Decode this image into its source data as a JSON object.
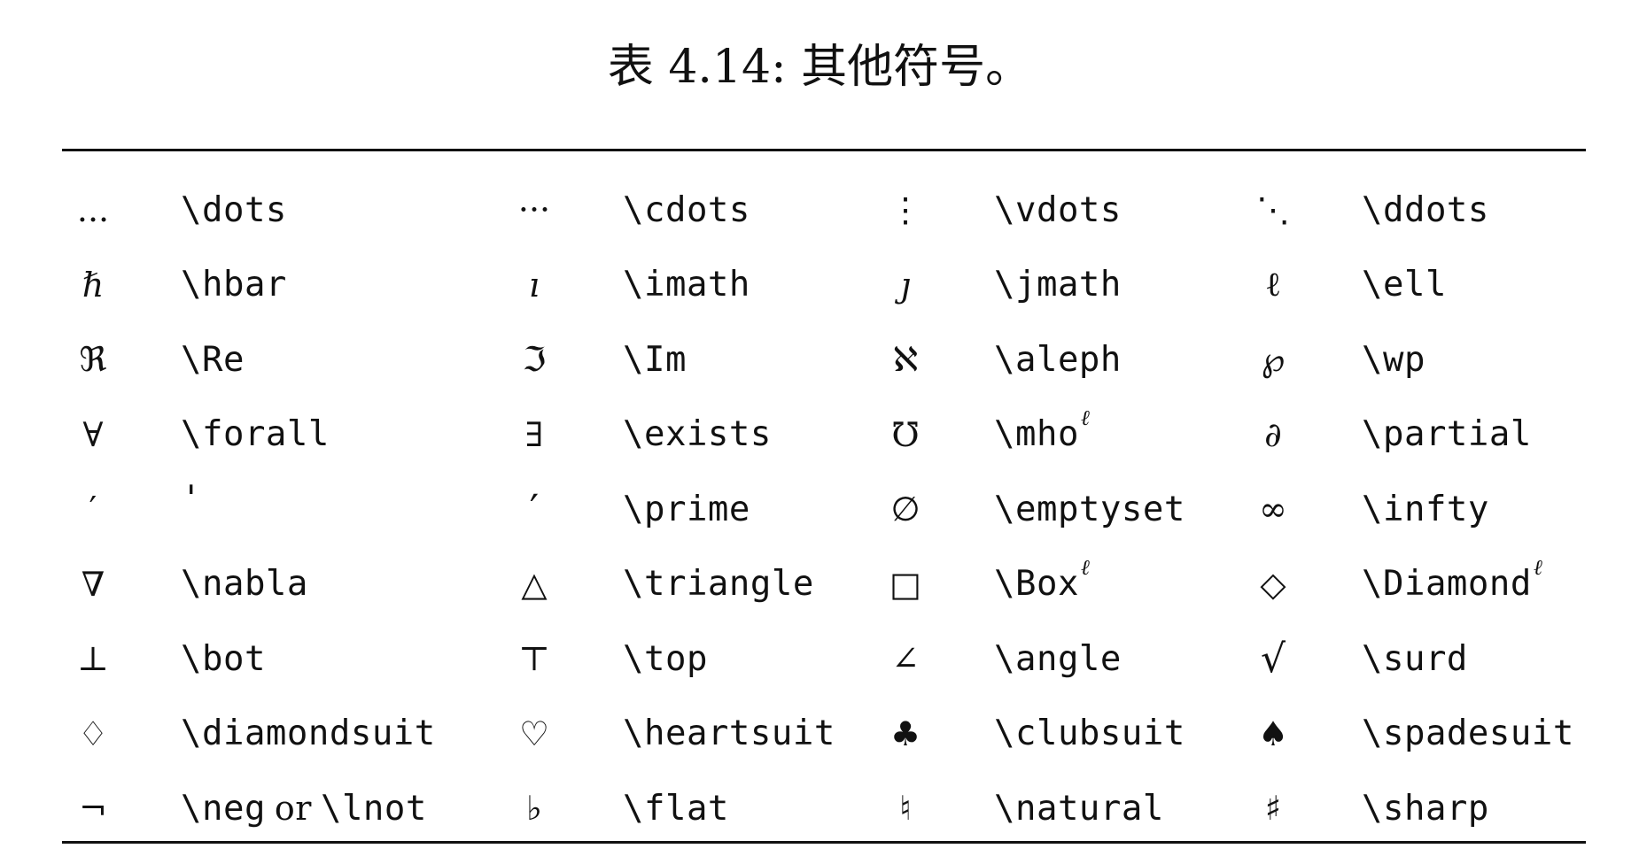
{
  "caption": "表 4.14: 其他符号。",
  "rows": [
    [
      {
        "sym": "...",
        "cmd": "\\dots"
      },
      {
        "sym": "···",
        "cmd": "\\cdots"
      },
      {
        "sym": "⋮",
        "cmd": "\\vdots"
      },
      {
        "sym": "⋱",
        "cmd": "\\ddots"
      }
    ],
    [
      {
        "sym": "ℏ",
        "cmd": "\\hbar"
      },
      {
        "sym": "ı",
        "cmd": "\\imath"
      },
      {
        "sym": "ȷ",
        "cmd": "\\jmath"
      },
      {
        "sym": "ℓ",
        "cmd": "\\ell"
      }
    ],
    [
      {
        "sym": "ℜ",
        "cmd": "\\Re"
      },
      {
        "sym": "ℑ",
        "cmd": "\\Im"
      },
      {
        "sym": "ℵ",
        "cmd": "\\aleph"
      },
      {
        "sym": "℘",
        "cmd": "\\wp"
      }
    ],
    [
      {
        "sym": "∀",
        "cmd": "\\forall"
      },
      {
        "sym": "∃",
        "cmd": "\\exists"
      },
      {
        "sym": "℧",
        "cmd": "\\mho",
        "sup": "ℓ"
      },
      {
        "sym": "∂",
        "cmd": "\\partial"
      }
    ],
    [
      {
        "sym": "′",
        "cmd": "'"
      },
      {
        "sym": "′",
        "cmd": "\\prime"
      },
      {
        "sym": "∅",
        "cmd": "\\emptyset"
      },
      {
        "sym": "∞",
        "cmd": "\\infty"
      }
    ],
    [
      {
        "sym": "∇",
        "cmd": "\\nabla"
      },
      {
        "sym": "△",
        "cmd": "\\triangle"
      },
      {
        "sym": "□",
        "cmd": "\\Box",
        "sup": "ℓ"
      },
      {
        "sym": "◇",
        "cmd": "\\Diamond",
        "sup": "ℓ"
      }
    ],
    [
      {
        "sym": "⊥",
        "cmd": "\\bot"
      },
      {
        "sym": "⊤",
        "cmd": "\\top"
      },
      {
        "sym": "∠",
        "cmd": "\\angle"
      },
      {
        "sym": "√",
        "cmd": "\\surd"
      }
    ],
    [
      {
        "sym": "♢",
        "cmd": "\\diamondsuit"
      },
      {
        "sym": "♡",
        "cmd": "\\heartsuit"
      },
      {
        "sym": "♣",
        "cmd": "\\clubsuit"
      },
      {
        "sym": "♠",
        "cmd": "\\spadesuit"
      }
    ],
    [
      {
        "sym": "¬",
        "cmd": "\\neg",
        "or": "or",
        "cmd2": "\\lnot"
      },
      {
        "sym": "♭",
        "cmd": "\\flat"
      },
      {
        "sym": "♮",
        "cmd": "\\natural"
      },
      {
        "sym": "♯",
        "cmd": "\\sharp"
      }
    ]
  ]
}
